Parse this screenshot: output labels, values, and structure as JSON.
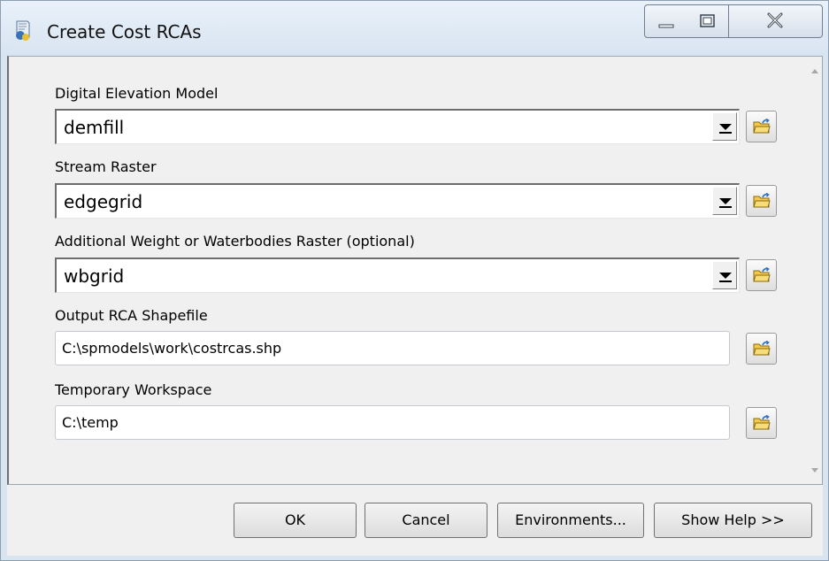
{
  "window": {
    "title": "Create Cost RCAs",
    "app_icon": "python-script-icon",
    "caption_buttons": [
      "minimize-icon",
      "maximize-icon",
      "close-icon"
    ]
  },
  "fields": {
    "dem": {
      "label": "Digital Elevation Model",
      "value": "demfill"
    },
    "stream": {
      "label": "Stream Raster",
      "value": "edgegrid"
    },
    "weight": {
      "label": "Additional Weight or Waterbodies Raster (optional)",
      "value": "wbgrid"
    },
    "output": {
      "label": "Output RCA Shapefile",
      "value": "C:\\spmodels\\work\\costrcas.shp"
    },
    "workspace": {
      "label": "Temporary Workspace",
      "value": "C:\\temp"
    }
  },
  "buttons": {
    "ok": "OK",
    "cancel": "Cancel",
    "environments": "Environments...",
    "show_help": "Show Help >>"
  },
  "icons": {
    "browse": "open-folder-icon",
    "dropdown": "chevron-down-icon"
  },
  "colors": {
    "folder": "#f2c94c",
    "folder_outline": "#8a6a10",
    "arrow": "#2a6fc9"
  }
}
